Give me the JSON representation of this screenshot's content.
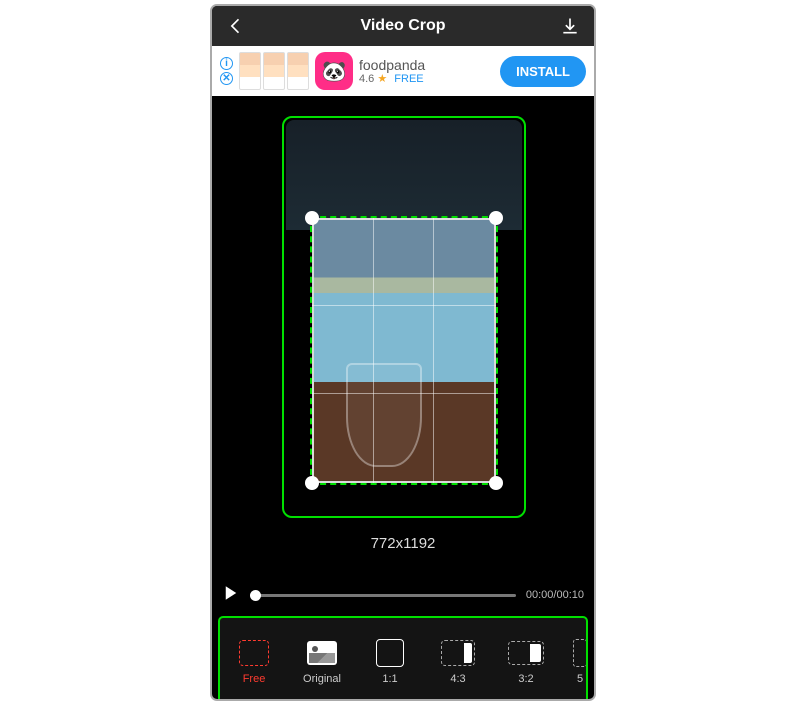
{
  "header": {
    "title": "Video Crop"
  },
  "ad": {
    "name": "foodpanda",
    "rating": "4.6",
    "price": "FREE",
    "cta": "INSTALL"
  },
  "crop": {
    "dimensions": "772x1192"
  },
  "timeline": {
    "time": "00:00/00:10"
  },
  "aspects": [
    {
      "key": "free",
      "label": "Free",
      "selected": true
    },
    {
      "key": "original",
      "label": "Original",
      "selected": false
    },
    {
      "key": "1_1",
      "label": "1:1",
      "selected": false
    },
    {
      "key": "4_3",
      "label": "4:3",
      "selected": false
    },
    {
      "key": "3_2",
      "label": "3:2",
      "selected": false
    },
    {
      "key": "5",
      "label": "5",
      "selected": false
    }
  ]
}
